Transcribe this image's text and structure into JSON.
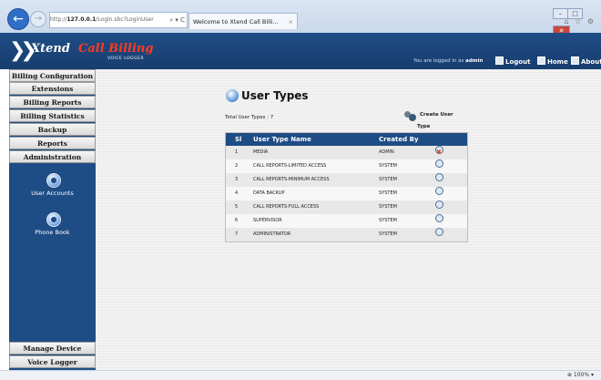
{
  "browser": {
    "url_prefix": "http://",
    "url_host": "127.0.0.1",
    "url_path": "/Login.sbc?LoginUser",
    "url_controls": "⌕ ▾ C",
    "tab_title": "Welcome to Xtend Call Billi...",
    "tab_close": "×",
    "win_controls": [
      "–",
      "□",
      "✕"
    ],
    "toolbar_icons": "⌂ ☆ ⚙"
  },
  "header": {
    "logo_part1": "Xtend",
    "logo_part2": "Call Billing",
    "logo_sub": "VOICE LOGGER",
    "logged_prefix": "You are logged in as",
    "logged_user": "admin",
    "logout": "Logout",
    "home": "Home",
    "about": "About"
  },
  "sidebar": {
    "menu": [
      "Billing Configuration",
      "Extensions",
      "Billing Reports",
      "Billing Statistics",
      "Backup",
      "Reports",
      "Administration"
    ],
    "sub_items": [
      "User Accounts",
      "Phone Book"
    ],
    "bottom": [
      "Manage Device",
      "Voice Logger"
    ]
  },
  "main": {
    "title": "User Types",
    "total_label": "Total User Types :",
    "total_value": "7",
    "create_line1": "Create User",
    "create_line2": "Type",
    "columns": [
      "Sl",
      "User Type Name",
      "Created By"
    ],
    "rows": [
      {
        "sl": "1",
        "name": "MEDIA",
        "by": "ADMIN",
        "deletable": true
      },
      {
        "sl": "2",
        "name": "CALL REPORTS-LIMITED ACCESS",
        "by": "SYSTEM",
        "deletable": false
      },
      {
        "sl": "3",
        "name": "CALL REPORTS-MINIMUM ACCESS",
        "by": "SYSTEM",
        "deletable": false
      },
      {
        "sl": "4",
        "name": "DATA BACKUP",
        "by": "SYSTEM",
        "deletable": false
      },
      {
        "sl": "5",
        "name": "CALL REPORTS-FULL ACCESS",
        "by": "SYSTEM",
        "deletable": false
      },
      {
        "sl": "6",
        "name": "SUPERVISOR",
        "by": "SYSTEM",
        "deletable": false
      },
      {
        "sl": "7",
        "name": "ADMINISTRATOR",
        "by": "SYSTEM",
        "deletable": false
      }
    ]
  },
  "statusbar": {
    "zoom": "⊕ 100%  ▾"
  },
  "icons": {
    "edit": "edit-icon",
    "delete": "delete-icon",
    "user_accounts": "users-icon",
    "phone_book": "phone-book-icon"
  },
  "colors": {
    "brand_blue": "#1e4c85",
    "logo_red": "#ff3a1f"
  }
}
